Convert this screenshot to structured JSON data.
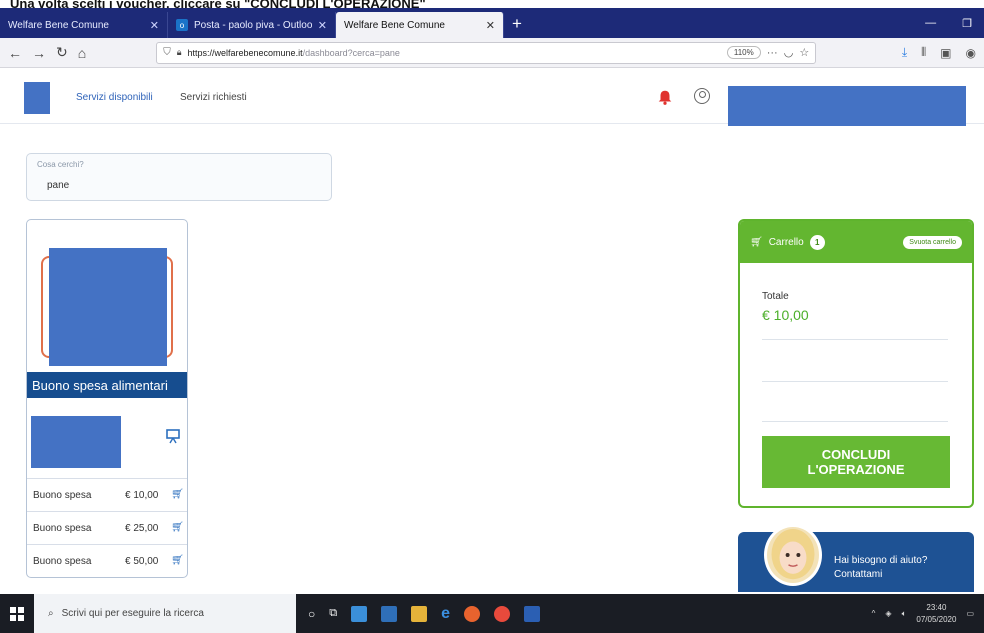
{
  "caption": {
    "text": "Una volta scelti i voucher, cliccare su \"CONCLUDI L'OPERAZIONE\""
  },
  "browser": {
    "tabs": [
      {
        "title": "Welfare Bene Comune"
      },
      {
        "title": "Posta - paolo piva - Outlook"
      },
      {
        "title": "Welfare Bene Comune"
      }
    ],
    "url_host": "https://welfarebenecomune.it",
    "url_path": "/dashboard?cerca=pane",
    "zoom": "110%"
  },
  "app": {
    "menu": {
      "available": "Servizi disponibili",
      "requested": "Servizi richiesti"
    },
    "search": {
      "label": "Cosa cerchi?",
      "value": "pane"
    },
    "product": {
      "title": "Buono spesa alimentari",
      "options": [
        {
          "name": "Buono spesa",
          "price": "€ 10,00"
        },
        {
          "name": "Buono spesa",
          "price": "€ 25,00"
        },
        {
          "name": "Buono spesa",
          "price": "€ 50,00"
        }
      ]
    },
    "cart": {
      "title": "Carrello",
      "count": "1",
      "empty_label": "Svuota carrello",
      "total_label": "Totale",
      "total_value": "€ 10,00",
      "button_line1": "CONCLUDI",
      "button_line2": "L'OPERAZIONE"
    },
    "help": {
      "line1": "Hai bisogno di aiuto?",
      "line2": "Contattami"
    }
  },
  "taskbar": {
    "search_placeholder": "Scrivi qui per eseguire la ricerca",
    "time": "23:40",
    "date": "07/05/2020"
  },
  "colors": {
    "brand_blue": "#164d8f",
    "cart_green": "#63b630",
    "redaction": "#4472c4"
  }
}
